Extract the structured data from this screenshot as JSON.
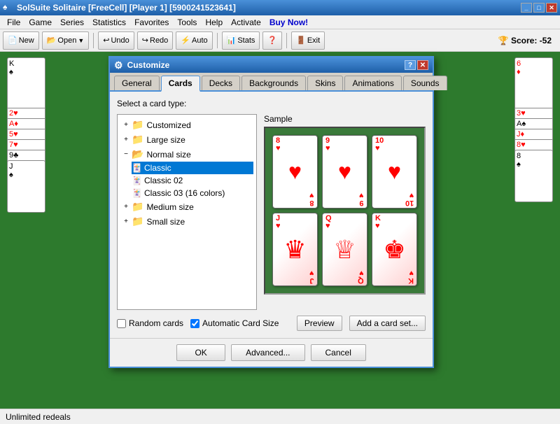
{
  "titlebar": {
    "title": "SolSuite Solitaire  [FreeCell]  [Player 1]  [5900241523641]",
    "icon": "♠",
    "controls": [
      "_",
      "□",
      "✕"
    ]
  },
  "menubar": {
    "items": [
      "File",
      "Game",
      "Series",
      "Statistics",
      "Favorites",
      "Tools",
      "Help",
      "Activate",
      "Buy Now!"
    ]
  },
  "toolbar": {
    "buttons": [
      "New",
      "Open",
      "Undo",
      "Redo",
      "Auto",
      "Stats",
      "?",
      "Exit"
    ],
    "score_label": "Score: -52"
  },
  "dialog": {
    "title": "Customize",
    "tabs": [
      "General",
      "Cards",
      "Decks",
      "Backgrounds",
      "Skins",
      "Animations",
      "Sounds"
    ],
    "active_tab": "Cards",
    "section_label": "Select a card type:",
    "tree": {
      "items": [
        {
          "label": "Customized",
          "level": 0,
          "type": "folder",
          "expanded": false
        },
        {
          "label": "Large size",
          "level": 0,
          "type": "folder",
          "expanded": false
        },
        {
          "label": "Normal size",
          "level": 0,
          "type": "folder",
          "expanded": true
        },
        {
          "label": "Classic",
          "level": 1,
          "type": "file",
          "selected": true
        },
        {
          "label": "Classic 02",
          "level": 1,
          "type": "file",
          "selected": false
        },
        {
          "label": "Classic 03 (16 colors)",
          "level": 1,
          "type": "file",
          "selected": false
        },
        {
          "label": "Medium size",
          "level": 0,
          "type": "folder",
          "expanded": false
        },
        {
          "label": "Small size",
          "level": 0,
          "type": "folder",
          "expanded": false
        }
      ]
    },
    "sample_label": "Sample",
    "sample_cards": [
      {
        "rank": "8",
        "suit": "♥",
        "color": "red"
      },
      {
        "rank": "9",
        "suit": "♥",
        "color": "red"
      },
      {
        "rank": "10",
        "suit": "♥",
        "color": "red"
      },
      {
        "rank": "J",
        "suit": "♥",
        "color": "red"
      },
      {
        "rank": "Q",
        "suit": "♥",
        "color": "red"
      },
      {
        "rank": "K",
        "suit": "♥",
        "color": "red"
      }
    ],
    "options": {
      "random_cards": {
        "label": "Random cards",
        "checked": false
      },
      "auto_card_size": {
        "label": "Automatic Card Size",
        "checked": true
      }
    },
    "buttons": {
      "preview": "Preview",
      "add_card_set": "Add a card set..."
    },
    "footer": {
      "ok": "OK",
      "advanced": "Advanced...",
      "cancel": "Cancel"
    }
  },
  "statusbar": {
    "text": "Unlimited redeals"
  }
}
